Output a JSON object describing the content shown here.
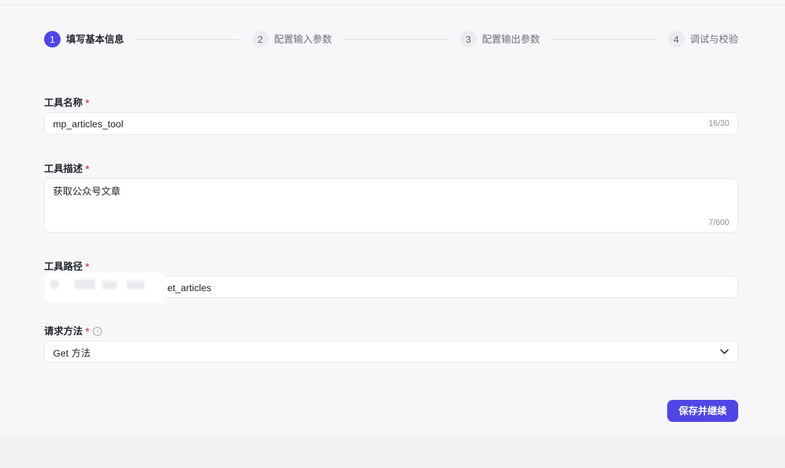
{
  "steps": [
    {
      "num": "1",
      "label": "填写基本信息",
      "active": true
    },
    {
      "num": "2",
      "label": "配置输入参数",
      "active": false
    },
    {
      "num": "3",
      "label": "配置输出参数",
      "active": false
    },
    {
      "num": "4",
      "label": "调试与校验",
      "active": false
    }
  ],
  "form": {
    "tool_name": {
      "label": "工具名称",
      "required_mark": "*",
      "value": "mp_articles_tool",
      "counter": "16/30"
    },
    "tool_desc": {
      "label": "工具描述",
      "required_mark": "*",
      "value": "获取公众号文章",
      "counter": "7/600"
    },
    "tool_path": {
      "label": "工具路径",
      "required_mark": "*",
      "value": "et_articles"
    },
    "method": {
      "label": "请求方法",
      "required_mark": "*",
      "info_icon": "info-circle-icon",
      "value": "Get 方法",
      "icon": "chevron-down-icon"
    }
  },
  "actions": {
    "save_continue": "保存并继续"
  },
  "colors": {
    "accent": "#4f46e5",
    "required": "#e5484d",
    "background": "#f7f7f9"
  }
}
